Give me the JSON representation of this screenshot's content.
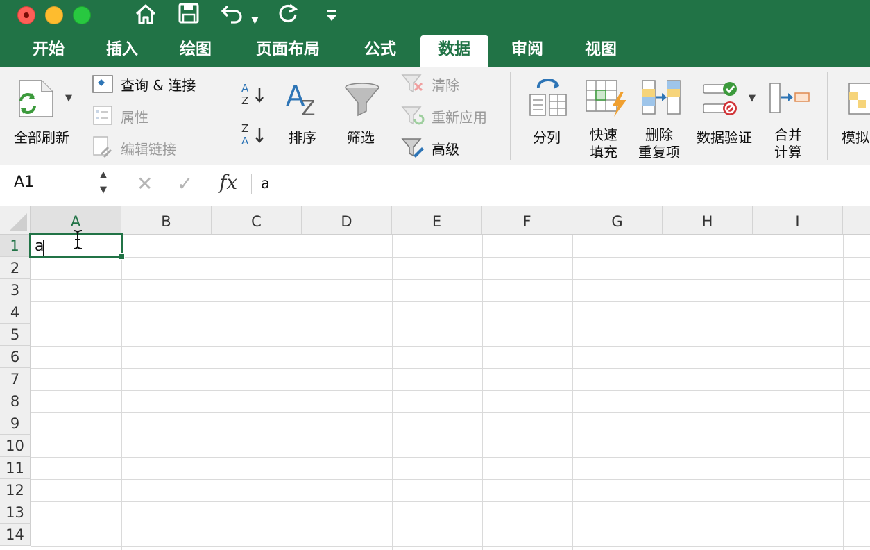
{
  "quick_access": {
    "home_icon": "home-icon",
    "save_icon": "save-icon",
    "undo_icon": "undo-icon",
    "redo_icon": "redo-icon",
    "customize_icon": "customize-icon"
  },
  "tabs": [
    {
      "label": "开始"
    },
    {
      "label": "插入"
    },
    {
      "label": "绘图"
    },
    {
      "label": "页面布局"
    },
    {
      "label": "公式"
    },
    {
      "label": "数据"
    },
    {
      "label": "审阅"
    },
    {
      "label": "视图"
    }
  ],
  "active_tab": "数据",
  "ribbon": {
    "refresh_all": "全部刷新",
    "query_connect": "查询 & 连接",
    "properties": "属性",
    "edit_links": "编辑链接",
    "sort": "排序",
    "filter": "筛选",
    "clear": "清除",
    "reapply": "重新应用",
    "advanced": "高级",
    "text_to_columns": "分列",
    "flash_fill_1": "快速",
    "flash_fill_2": "填充",
    "remove_dup_1": "删除",
    "remove_dup_2": "重复项",
    "data_validation": "数据验证",
    "consolidate_1": "合并",
    "consolidate_2": "计算",
    "what_if": "模拟"
  },
  "formula_bar": {
    "name_box": "A1",
    "fx_label": "fx",
    "formula": "a"
  },
  "grid": {
    "columns": [
      "A",
      "B",
      "C",
      "D",
      "E",
      "F",
      "G",
      "H",
      "I"
    ],
    "rows": [
      "1",
      "2",
      "3",
      "4",
      "5",
      "6",
      "7",
      "8",
      "9",
      "10",
      "11",
      "12",
      "13",
      "14"
    ],
    "selected_cell": "A1",
    "cell_a1": "a"
  },
  "colors": {
    "accent": "#217346",
    "ribbon_bg": "#f2f2f2"
  }
}
